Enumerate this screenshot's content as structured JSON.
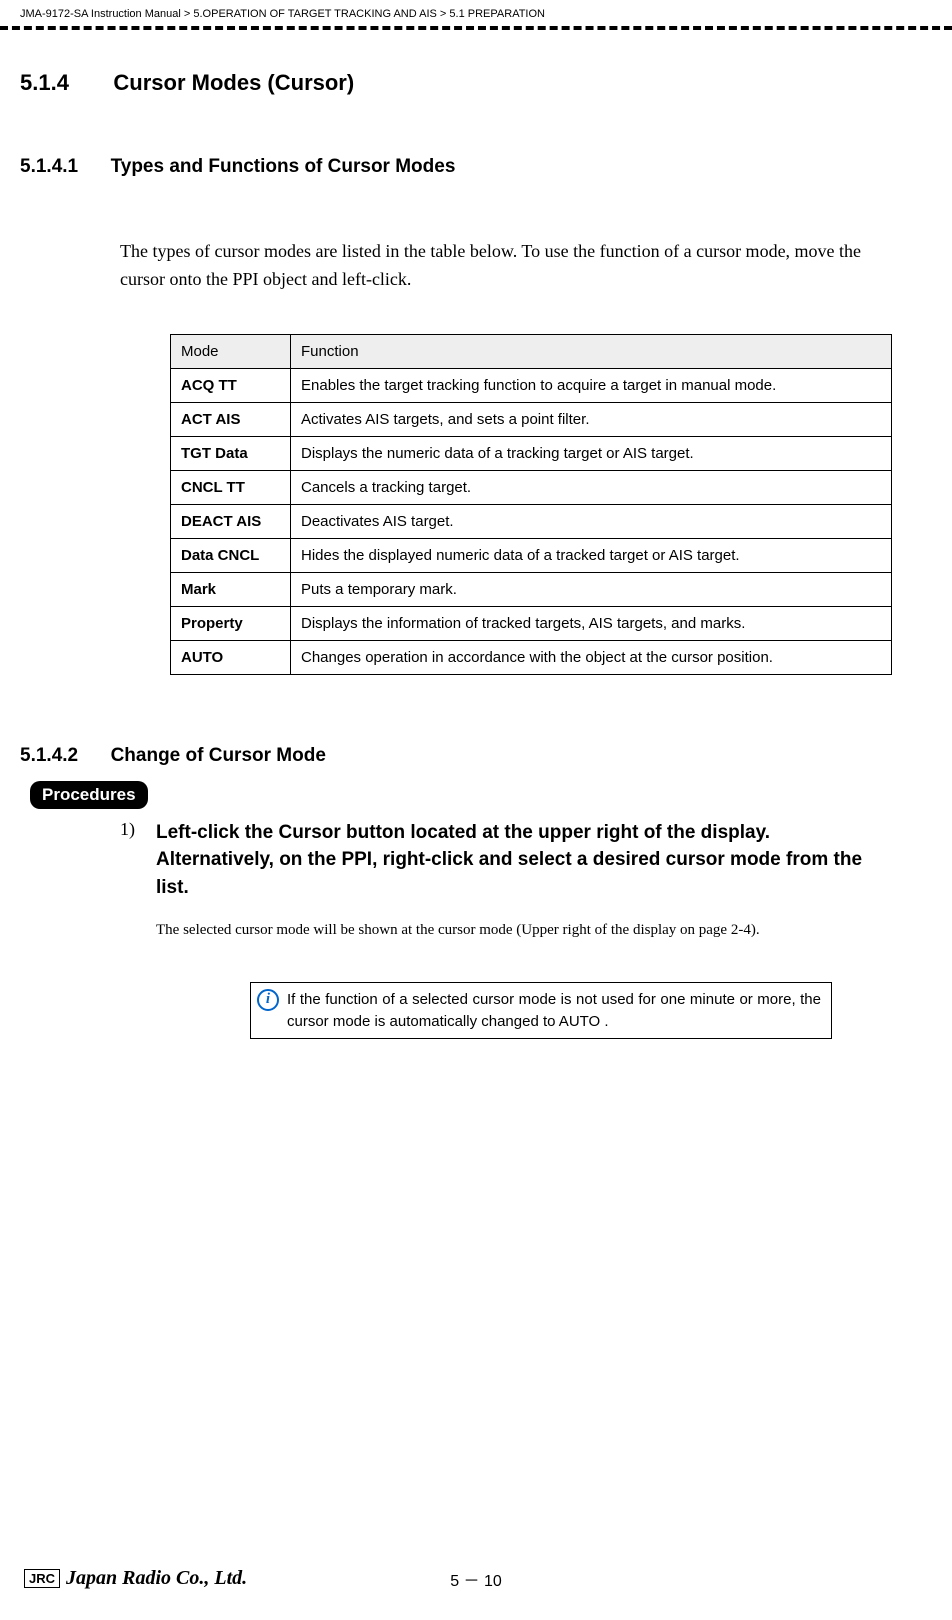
{
  "breadcrumb": {
    "part1": "JMA-9172-SA Instruction Manual",
    "sep1": ">",
    "part2": "5.OPERATION OF TARGET TRACKING AND AIS",
    "sep2": ">",
    "part3": "5.1  PREPARATION"
  },
  "section": {
    "num": "5.1.4",
    "title": "Cursor Modes (Cursor)"
  },
  "sub1": {
    "num": "5.1.4.1",
    "title": "Types and Functions of Cursor Modes",
    "body": "The types of cursor modes are listed in the table below. To use the function of a cursor mode, move the cursor onto the PPI object and left-click."
  },
  "table": {
    "head_mode": "Mode",
    "head_func": "Function",
    "rows": [
      {
        "mode": "ACQ TT",
        "func": "Enables the target tracking function to acquire a target in manual mode."
      },
      {
        "mode": "ACT AIS",
        "func": "Activates AIS targets, and sets a point filter."
      },
      {
        "mode": "TGT Data",
        "func": "Displays the numeric data of a tracking target or AIS target."
      },
      {
        "mode": "CNCL TT",
        "func": "Cancels a tracking target."
      },
      {
        "mode": "DEACT AIS",
        "func": "Deactivates AIS target."
      },
      {
        "mode": "Data CNCL",
        "func": "Hides the displayed numeric data of a tracked target or AIS target."
      },
      {
        "mode": "Mark",
        "func": "Puts a temporary mark."
      },
      {
        "mode": "Property",
        "func": "Displays the information of tracked targets, AIS targets, and marks."
      },
      {
        "mode": "AUTO",
        "func": "Changes operation in accordance with the object at the cursor position."
      }
    ]
  },
  "sub2": {
    "num": "5.1.4.2",
    "title": "Change of Cursor Mode",
    "procedures_label": "Procedures",
    "step_num": "1)",
    "step_text": "Left-click the  Cursor  button located at the upper right of the display. Alternatively, on the PPI, right-click and select a desired cursor mode from the list.",
    "step_note": "The selected cursor mode will be shown at the cursor mode (Upper right of the display on page 2-4).",
    "info_icon": "i",
    "info_text": "If the function of a selected cursor mode is not used for one minute or more, the cursor mode is automatically changed to AUTO ."
  },
  "footer": {
    "jrc": "JRC",
    "company": "Japan Radio Co., Ltd.",
    "page": "5 － 10"
  }
}
